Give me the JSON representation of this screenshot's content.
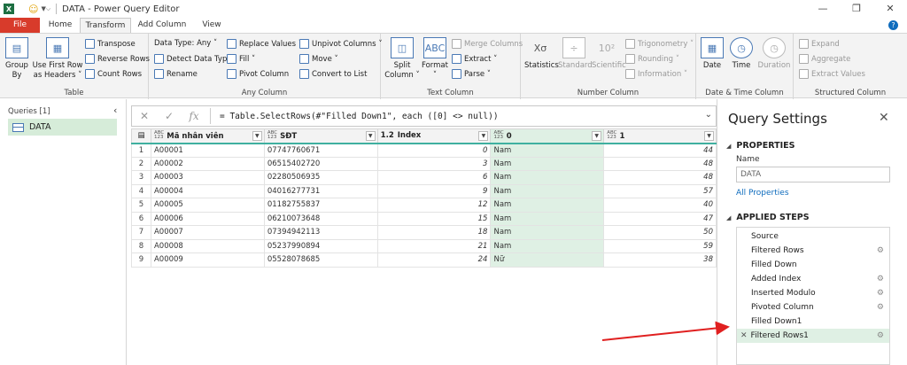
{
  "window": {
    "title": "DATA - Power Query Editor",
    "excel_icon": "X",
    "controls": [
      "—",
      "❐",
      "✕"
    ]
  },
  "tabs": [
    "File",
    "Home",
    "Transform",
    "Add Column",
    "View"
  ],
  "ribbon": {
    "table": {
      "label": "Table",
      "group_by": "Group By",
      "first_row": "Use First Row as Headers ˅",
      "transpose": "Transpose",
      "reverse": "Reverse Rows",
      "count": "Count Rows"
    },
    "any_column": {
      "label": "Any Column",
      "data_type": "Data Type: Any ˅",
      "detect": "Detect Data Type",
      "rename": "Rename",
      "replace": "Replace Values ˅",
      "fill": "Fill ˅",
      "pivot": "Pivot Column",
      "unpivot": "Unpivot Columns ˅",
      "move": "Move ˅",
      "convert": "Convert to List"
    },
    "text_column": {
      "label": "Text Column",
      "split": "Split Column ˅",
      "format": "Format ˅",
      "merge": "Merge Columns",
      "extract": "Extract ˅",
      "parse": "Parse ˅"
    },
    "number_column": {
      "label": "Number Column",
      "statistics": "Statistics",
      "standard": "Standard",
      "scientific": "Scientific",
      "trig": "Trigonometry ˅",
      "rounding": "Rounding ˅",
      "information": "Information ˅",
      "stat_icon": "Xσ",
      "stat_sub": "Σ",
      "sci_icon": "10²"
    },
    "datetime": {
      "label": "Date & Time Column",
      "date": "Date",
      "time": "Time",
      "duration": "Duration"
    },
    "structured": {
      "label": "Structured Column",
      "expand": "Expand",
      "aggregate": "Aggregate",
      "extract_values": "Extract Values"
    }
  },
  "queries": {
    "header": "Queries [1]",
    "items": [
      "DATA"
    ]
  },
  "formula": {
    "text": "= Table.SelectRows(#\"Filled Down1\", each ([0] <> null))",
    "cancel": "✕",
    "accept": "✓",
    "fx": "fx"
  },
  "table": {
    "columns": [
      {
        "name": "Mã nhân viên",
        "type": "ABC 123"
      },
      {
        "name": "SĐT",
        "type": "ABC 123"
      },
      {
        "name": "Index",
        "type": "1.2"
      },
      {
        "name": "0",
        "type": "ABC 123"
      },
      {
        "name": "1",
        "type": "ABC 123"
      }
    ],
    "rows": [
      [
        "1",
        "A00001",
        "07747760671",
        "0",
        "Nam",
        "44"
      ],
      [
        "2",
        "A00002",
        "06515402720",
        "3",
        "Nam",
        "48"
      ],
      [
        "3",
        "A00003",
        "02280506935",
        "6",
        "Nam",
        "48"
      ],
      [
        "4",
        "A00004",
        "04016277731",
        "9",
        "Nam",
        "57"
      ],
      [
        "5",
        "A00005",
        "01182755837",
        "12",
        "Nam",
        "40"
      ],
      [
        "6",
        "A00006",
        "06210073648",
        "15",
        "Nam",
        "47"
      ],
      [
        "7",
        "A00007",
        "07394942113",
        "18",
        "Nam",
        "50"
      ],
      [
        "8",
        "A00008",
        "05237990894",
        "21",
        "Nam",
        "59"
      ],
      [
        "9",
        "A00009",
        "05528078685",
        "24",
        "Nữ",
        "38"
      ]
    ]
  },
  "settings": {
    "title": "Query Settings",
    "properties": "PROPERTIES",
    "name_label": "Name",
    "name_value": "DATA",
    "all_props": "All Properties",
    "applied": "APPLIED STEPS",
    "steps": [
      {
        "name": "Source",
        "gear": false
      },
      {
        "name": "Filtered Rows",
        "gear": true
      },
      {
        "name": "Filled Down",
        "gear": false
      },
      {
        "name": "Added Index",
        "gear": true
      },
      {
        "name": "Inserted Modulo",
        "gear": true
      },
      {
        "name": "Pivoted Column",
        "gear": true
      },
      {
        "name": "Filled Down1",
        "gear": false
      },
      {
        "name": "Filtered Rows1",
        "gear": true,
        "active": true
      }
    ]
  },
  "colors": {
    "accent_green": "#217346",
    "file_tab": "#d83b2b",
    "selected": "#dff0e4",
    "annotation_arrow": "#e02020"
  }
}
